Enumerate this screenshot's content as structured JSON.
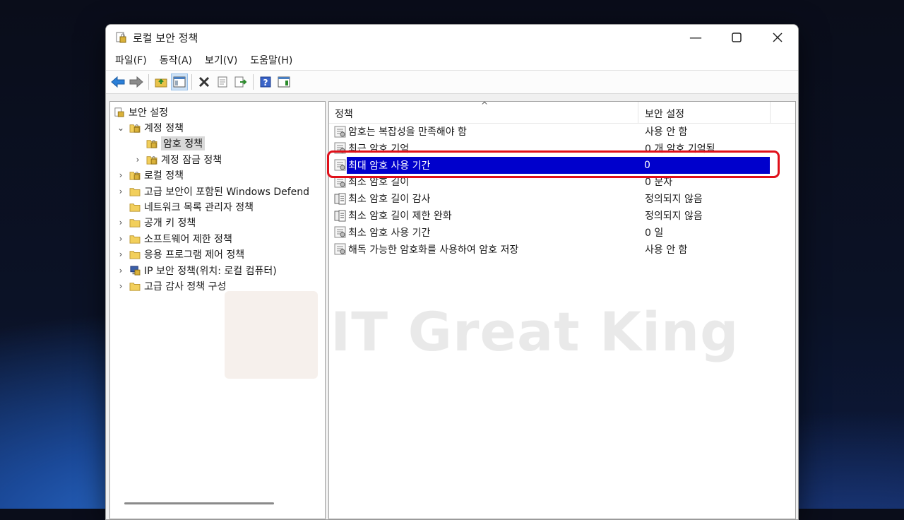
{
  "window": {
    "title": "로컬 보안 정책"
  },
  "menu": [
    "파일(F)",
    "동작(A)",
    "보기(V)",
    "도움말(H)"
  ],
  "tree": {
    "root": "보안 설정",
    "items": [
      {
        "label": "계정 정책",
        "depth": 1,
        "expander": "open",
        "icon": "lock-folder-icon"
      },
      {
        "label": "암호 정책",
        "depth": 2,
        "expander": "none",
        "icon": "lock-folder-icon",
        "selected": true
      },
      {
        "label": "계정 잠금 정책",
        "depth": 2,
        "expander": "closed",
        "icon": "lock-folder-icon"
      },
      {
        "label": "로컬 정책",
        "depth": 1,
        "expander": "closed",
        "icon": "lock-folder-icon"
      },
      {
        "label": "고급 보안이 포함된 Windows Defend",
        "depth": 1,
        "expander": "closed",
        "icon": "folder-icon"
      },
      {
        "label": "네트워크 목록 관리자 정책",
        "depth": 1,
        "expander": "none",
        "icon": "folder-icon"
      },
      {
        "label": "공개 키 정책",
        "depth": 1,
        "expander": "closed",
        "icon": "folder-icon"
      },
      {
        "label": "소프트웨어 제한 정책",
        "depth": 1,
        "expander": "closed",
        "icon": "folder-icon"
      },
      {
        "label": "응용 프로그램 제어 정책",
        "depth": 1,
        "expander": "closed",
        "icon": "folder-icon"
      },
      {
        "label": "IP 보안 정책(위치: 로컬 컴퓨터)",
        "depth": 1,
        "expander": "closed",
        "icon": "ip-security-icon"
      },
      {
        "label": "고급 감사 정책 구성",
        "depth": 1,
        "expander": "closed",
        "icon": "folder-icon"
      }
    ]
  },
  "list": {
    "columns": [
      "정책",
      "보안 설정"
    ],
    "rows": [
      {
        "policy": "암호는 복잡성을 만족해야 함",
        "setting": "사용 안 함",
        "icon": "policy-icon"
      },
      {
        "policy": "최근 암호 기억",
        "setting": "0 개 암호 기억됨",
        "icon": "policy-icon"
      },
      {
        "policy": "최대 암호 사용 기간",
        "setting": "0",
        "icon": "policy-icon",
        "selected": true
      },
      {
        "policy": "최소 암호 길이",
        "setting": "0 문자",
        "icon": "policy-icon"
      },
      {
        "policy": "최소 암호 길이 감사",
        "setting": "정의되지 않음",
        "icon": "audit-policy-icon"
      },
      {
        "policy": "최소 암호 길이 제한 완화",
        "setting": "정의되지 않음",
        "icon": "audit-policy-icon"
      },
      {
        "policy": "최소 암호 사용 기간",
        "setting": "0 일",
        "icon": "policy-icon"
      },
      {
        "policy": "해독 가능한 암호화를 사용하여 암호 저장",
        "setting": "사용 안 함",
        "icon": "policy-icon"
      }
    ]
  },
  "watermark": "IT Great King",
  "colors": {
    "selection": "#0000cc",
    "highlight": "#e0101a"
  }
}
